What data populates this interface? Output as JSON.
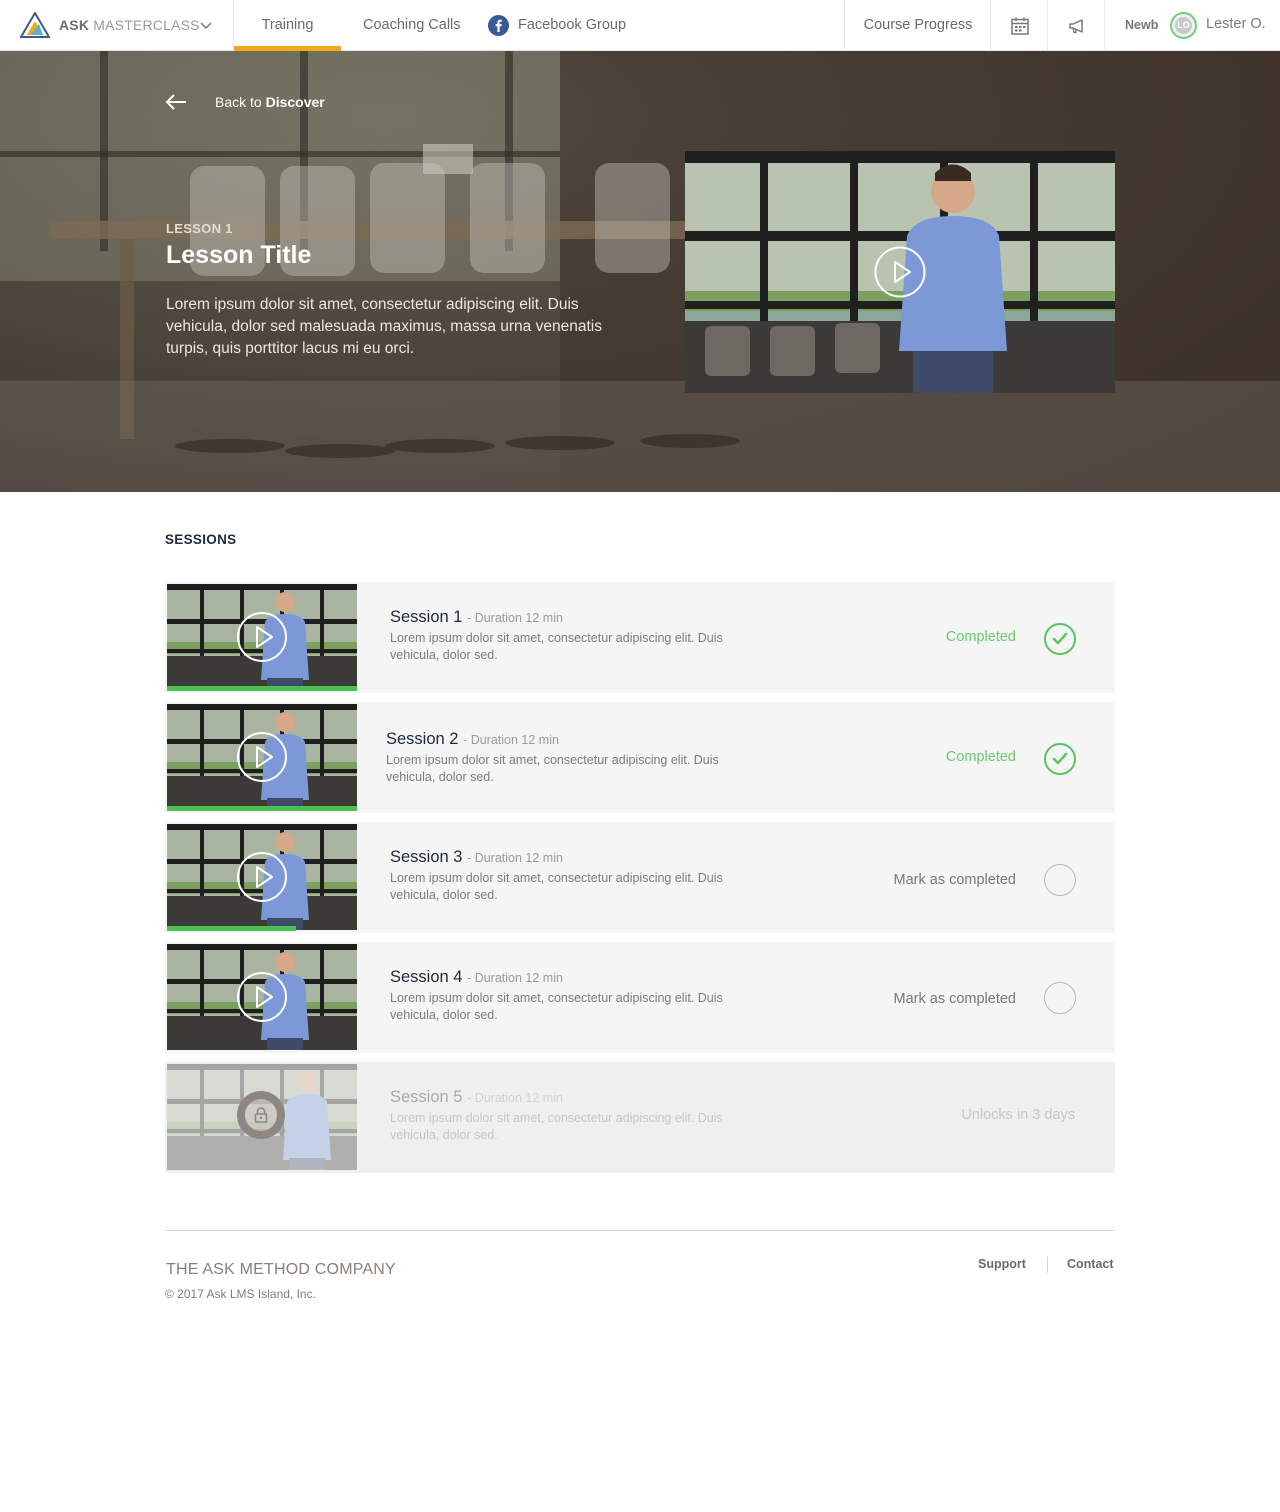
{
  "brand": {
    "name_bold": "ASK",
    "name_light": "MASTERCLASS"
  },
  "nav": {
    "training": "Training",
    "coaching": "Coaching Calls",
    "facebook": "Facebook Group",
    "course_progress": "Course Progress",
    "user_rank": "Newb",
    "user_initials": "LO",
    "user_name": "Lester O."
  },
  "hero": {
    "back_prefix": "Back to",
    "back_target": "Discover",
    "lesson_number": "LESSON 1",
    "lesson_title": "Lesson Title",
    "lesson_description": "Lorem ipsum dolor sit amet, consectetur adipiscing elit. Duis vehicula, dolor sed malesuada maximus, massa urna venenatis turpis, quis porttitor lacus mi eu orci."
  },
  "sessions_heading": "SESSIONS",
  "sessions": [
    {
      "title": "Session 1",
      "duration": "- Duration 12 min",
      "description": "Lorem ipsum dolor sit amet, consectetur adipiscing elit. Duis vehicula, dolor sed.",
      "status": "Completed",
      "state": "completed",
      "progress": 1.0
    },
    {
      "title": "Session 2",
      "duration": "- Duration 12 min",
      "description": "Lorem ipsum dolor sit amet, consectetur adipiscing elit. Duis vehicula, dolor sed.",
      "status": "Completed",
      "state": "completed",
      "progress": 1.0
    },
    {
      "title": "Session 3",
      "duration": "- Duration 12 min",
      "description": "Lorem ipsum dolor sit amet, consectetur adipiscing elit. Duis vehicula, dolor sed.",
      "status": "Mark as completed",
      "state": "in-progress",
      "progress": 0.68
    },
    {
      "title": "Session 4",
      "duration": "- Duration 12 min",
      "description": "Lorem ipsum dolor sit amet, consectetur adipiscing elit. Duis vehicula, dolor sed.",
      "status": "Mark as completed",
      "state": "not-started",
      "progress": 0
    },
    {
      "title": "Session 5",
      "duration": "- Duration 12 min",
      "description": "Lorem ipsum dolor sit amet, consectetur adipiscing elit. Duis vehicula, dolor sed.",
      "status": "Unlocks in 3 days",
      "state": "locked",
      "progress": 0
    }
  ],
  "footer": {
    "company": "THE ASK METHOD COMPANY",
    "copyright": "© 2017 Ask LMS Island, Inc.",
    "support": "Support",
    "contact": "Contact"
  },
  "colors": {
    "accent": "#f2a81d",
    "complete_green": "#4cc152",
    "facebook_blue": "#3b5998",
    "heading_navy": "#1f2a3a"
  }
}
